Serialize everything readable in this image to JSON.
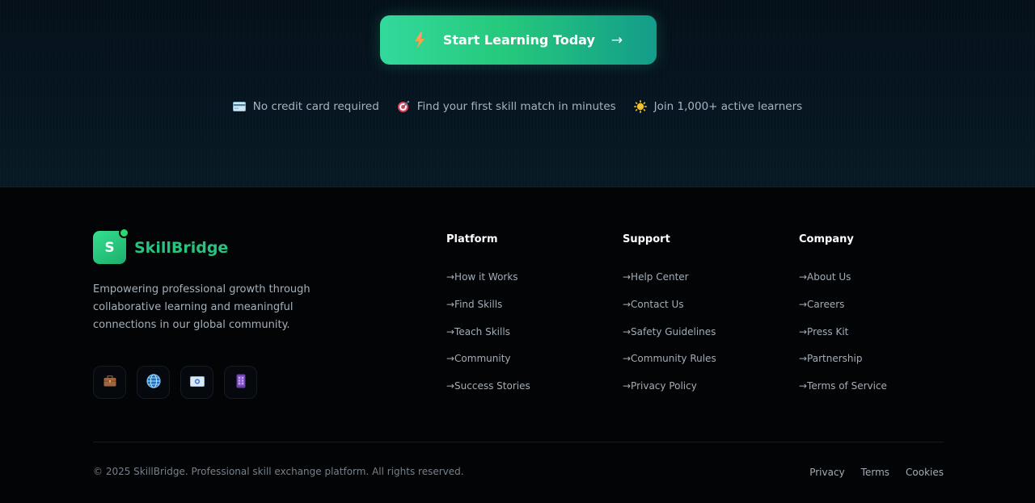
{
  "cta": {
    "button_label": "Start Learning Today",
    "button_arrow": "→",
    "button_icon": "lightning-icon",
    "perks": [
      {
        "icon": "credit-card-icon",
        "text": "No credit card required"
      },
      {
        "icon": "target-icon",
        "text": "Find your first skill match in minutes"
      },
      {
        "icon": "sparkle-icon",
        "text": "Join 1,000+ active learners"
      }
    ]
  },
  "brand": {
    "logo_letter": "S",
    "name": "SkillBridge",
    "tagline": "Empowering professional growth through collaborative learning and meaningful connections in our global community.",
    "accent_color": "#27c480"
  },
  "socials": [
    {
      "icon": "briefcase-icon"
    },
    {
      "icon": "globe-icon"
    },
    {
      "icon": "email-icon"
    },
    {
      "icon": "mobile-phone-icon"
    }
  ],
  "columns": [
    {
      "title": "Platform",
      "links": [
        "→How it Works",
        "→Find Skills",
        "→Teach Skills",
        "→Community",
        "→Success Stories"
      ]
    },
    {
      "title": "Support",
      "links": [
        "→Help Center",
        "→Contact Us",
        "→Safety Guidelines",
        "→Community Rules",
        "→Privacy Policy"
      ]
    },
    {
      "title": "Company",
      "links": [
        "→About Us",
        "→Careers",
        "→Press Kit",
        "→Partnership",
        "→Terms of Service"
      ]
    }
  ],
  "bottom": {
    "copyright": "© 2025 SkillBridge. Professional skill exchange platform. All rights reserved.",
    "legal_links": [
      "Privacy",
      "Terms",
      "Cookies"
    ]
  }
}
